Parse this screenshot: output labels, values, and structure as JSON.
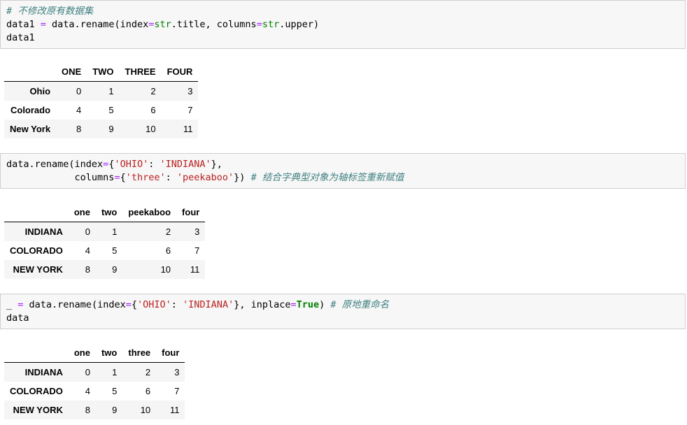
{
  "cells": [
    {
      "lines": [
        [
          {
            "t": "# 不修改原有数据集",
            "c": "c"
          }
        ],
        [
          {
            "t": "data1 "
          },
          {
            "t": "=",
            "c": "o"
          },
          {
            "t": " data.rename(index"
          },
          {
            "t": "=",
            "c": "o"
          },
          {
            "t": "str",
            "c": "b"
          },
          {
            "t": ".title, columns"
          },
          {
            "t": "=",
            "c": "o"
          },
          {
            "t": "str",
            "c": "b"
          },
          {
            "t": ".upper)"
          }
        ],
        [
          {
            "t": "data1"
          }
        ]
      ],
      "table": {
        "columns": [
          "ONE",
          "TWO",
          "THREE",
          "FOUR"
        ],
        "rows": [
          {
            "index": "Ohio",
            "values": [
              "0",
              "1",
              "2",
              "3"
            ]
          },
          {
            "index": "Colorado",
            "values": [
              "4",
              "5",
              "6",
              "7"
            ]
          },
          {
            "index": "New York",
            "values": [
              "8",
              "9",
              "10",
              "11"
            ]
          }
        ]
      }
    },
    {
      "lines": [
        [
          {
            "t": "data.rename(index"
          },
          {
            "t": "=",
            "c": "o"
          },
          {
            "t": "{"
          },
          {
            "t": "'OHIO'",
            "c": "s"
          },
          {
            "t": ": "
          },
          {
            "t": "'INDIANA'",
            "c": "s"
          },
          {
            "t": "},"
          }
        ],
        [
          {
            "t": "            columns"
          },
          {
            "t": "=",
            "c": "o"
          },
          {
            "t": "{"
          },
          {
            "t": "'three'",
            "c": "s"
          },
          {
            "t": ": "
          },
          {
            "t": "'peekaboo'",
            "c": "s"
          },
          {
            "t": "}) "
          },
          {
            "t": "# 结合字典型对象为轴标签重新赋值",
            "c": "c"
          }
        ]
      ],
      "table": {
        "columns": [
          "one",
          "two",
          "peekaboo",
          "four"
        ],
        "rows": [
          {
            "index": "INDIANA",
            "values": [
              "0",
              "1",
              "2",
              "3"
            ]
          },
          {
            "index": "COLORADO",
            "values": [
              "4",
              "5",
              "6",
              "7"
            ]
          },
          {
            "index": "NEW YORK",
            "values": [
              "8",
              "9",
              "10",
              "11"
            ]
          }
        ]
      }
    },
    {
      "lines": [
        [
          {
            "t": "_ "
          },
          {
            "t": "=",
            "c": "o"
          },
          {
            "t": " data.rename(index"
          },
          {
            "t": "=",
            "c": "o"
          },
          {
            "t": "{"
          },
          {
            "t": "'OHIO'",
            "c": "s"
          },
          {
            "t": ": "
          },
          {
            "t": "'INDIANA'",
            "c": "s"
          },
          {
            "t": "}, inplace"
          },
          {
            "t": "=",
            "c": "o"
          },
          {
            "t": "True",
            "c": "k"
          },
          {
            "t": ") "
          },
          {
            "t": "# 原地重命名",
            "c": "c"
          }
        ],
        [
          {
            "t": "data"
          }
        ]
      ],
      "table": {
        "columns": [
          "one",
          "two",
          "three",
          "four"
        ],
        "rows": [
          {
            "index": "INDIANA",
            "values": [
              "0",
              "1",
              "2",
              "3"
            ]
          },
          {
            "index": "COLORADO",
            "values": [
              "4",
              "5",
              "6",
              "7"
            ]
          },
          {
            "index": "NEW YORK",
            "values": [
              "8",
              "9",
              "10",
              "11"
            ]
          }
        ]
      }
    }
  ]
}
